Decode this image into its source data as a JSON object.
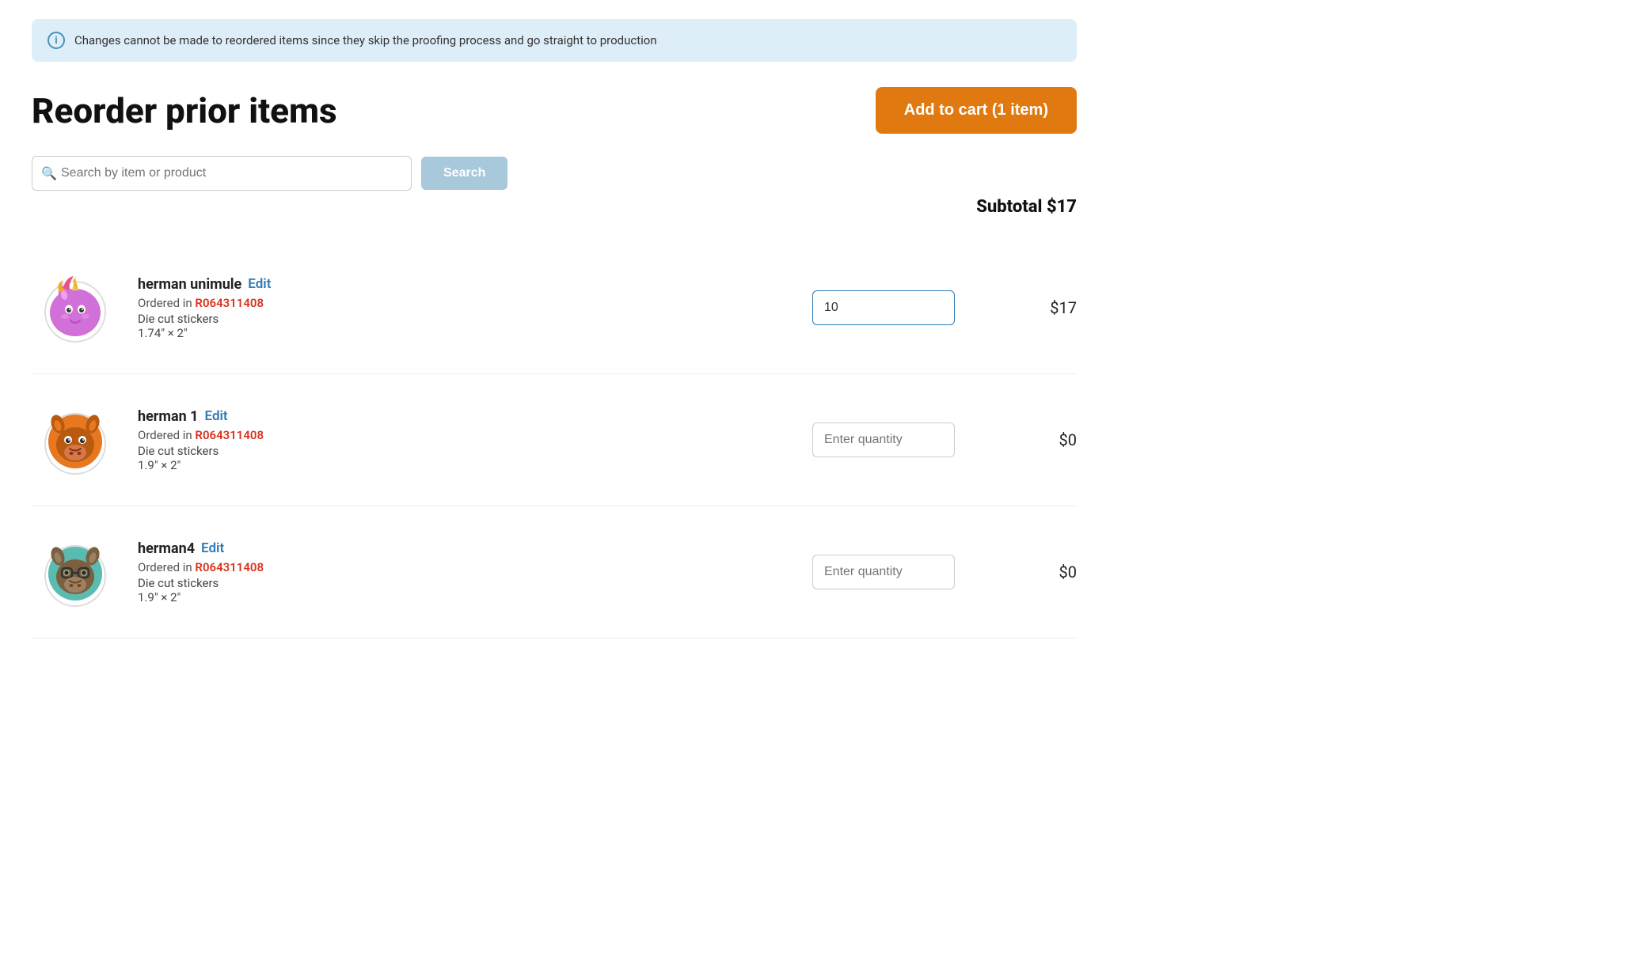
{
  "banner": {
    "text": "Changes cannot be made to reordered items since they skip the proofing process and go straight to production"
  },
  "page": {
    "title": "Reorder prior items"
  },
  "add_to_cart": {
    "label": "Add to cart (1 item)"
  },
  "search": {
    "placeholder": "Search by item or product",
    "button_label": "Search"
  },
  "subtotal": {
    "label": "Subtotal $17"
  },
  "products": [
    {
      "name": "herman unimule",
      "edit_label": "Edit",
      "ordered_label": "Ordered in",
      "order_id": "R064311408",
      "type": "Die cut stickers",
      "size": "1.74\" × 2\"",
      "quantity": "10",
      "quantity_placeholder": "",
      "price": "$17",
      "sticker_type": "unicorn"
    },
    {
      "name": "herman 1",
      "edit_label": "Edit",
      "ordered_label": "Ordered in",
      "order_id": "R064311408",
      "type": "Die cut stickers",
      "size": "1.9\" × 2\"",
      "quantity": "",
      "quantity_placeholder": "Enter quantity",
      "price": "$0",
      "sticker_type": "donkey_orange"
    },
    {
      "name": "herman4",
      "edit_label": "Edit",
      "ordered_label": "Ordered in",
      "order_id": "R064311408",
      "type": "Die cut stickers",
      "size": "1.9\" × 2\"",
      "quantity": "",
      "quantity_placeholder": "Enter quantity",
      "price": "$0",
      "sticker_type": "donkey_teal"
    }
  ]
}
